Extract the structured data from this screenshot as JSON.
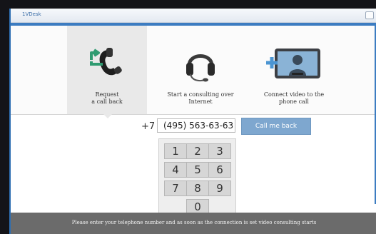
{
  "window": {
    "title": "1VDesk"
  },
  "tabs": [
    {
      "label": "Request\na call back",
      "icon": "phone-callback-icon",
      "active": true
    },
    {
      "label": "Start a consulting over\nInternet",
      "icon": "headset-icon",
      "active": false
    },
    {
      "label": "Connect video to the\nphone call",
      "icon": "video-call-icon",
      "active": false
    }
  ],
  "phone": {
    "prefix": "+7",
    "value": "(495) 563-63-63",
    "button_label": "Call me back"
  },
  "keypad": {
    "keys": [
      "1",
      "2",
      "3",
      "4",
      "5",
      "6",
      "7",
      "8",
      "9",
      "0"
    ]
  },
  "footer": {
    "text": "Please enter your telephone number and as soon as the connection is set video consulting starts"
  },
  "colors": {
    "accent": "#3c7cc1",
    "button": "#7ea7cf",
    "footer": "#6b6b6b",
    "arrow": "#2f9b71"
  }
}
